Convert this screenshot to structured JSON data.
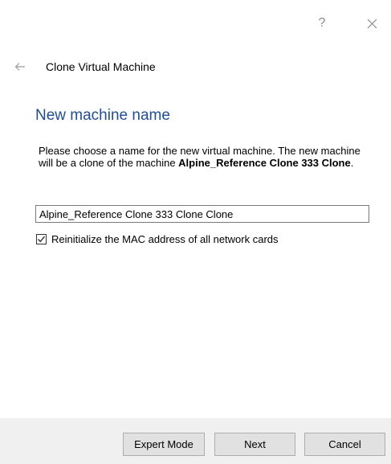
{
  "titlebar": {
    "help_label": "?",
    "close_icon": "close-icon"
  },
  "wizard": {
    "back_icon": "back-arrow-icon",
    "title": "Clone Virtual Machine",
    "heading": "New machine name",
    "description_prefix": "Please choose a name for the new virtual machine. The new machine will be a clone of the machine ",
    "source_machine": "Alpine_Reference Clone 333 Clone",
    "description_suffix": ".",
    "name_value": "Alpine_Reference Clone 333 Clone Clone",
    "mac_checkbox_label": "Reinitialize the MAC address of all network cards",
    "mac_checked": true
  },
  "buttons": {
    "expert": "Expert Mode",
    "next": "Next",
    "cancel": "Cancel"
  },
  "colors": {
    "heading": "#1f4e96",
    "footer_bg": "#f0f0f0",
    "button_bg": "#e1e1e1"
  }
}
